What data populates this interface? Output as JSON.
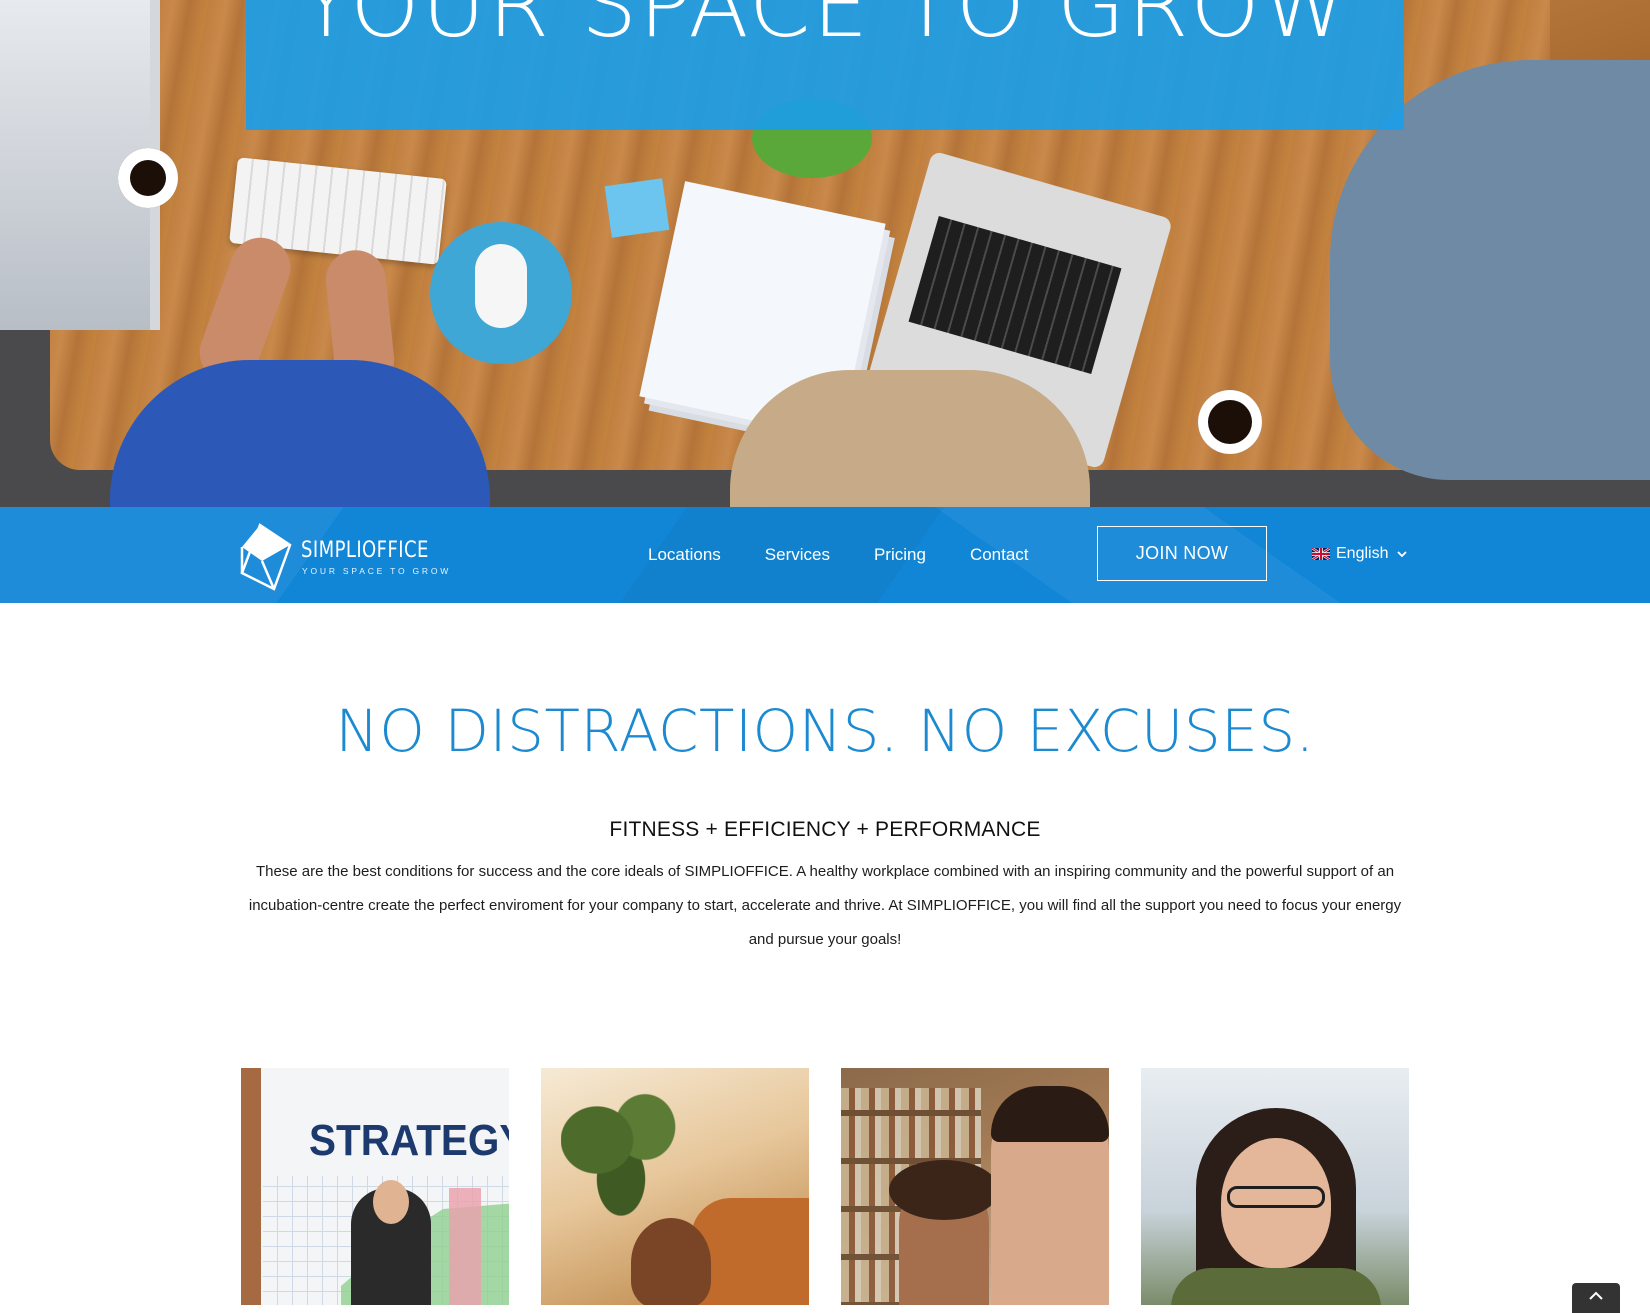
{
  "hero": {
    "title": "YOUR SPACE TO GROW"
  },
  "nav": {
    "logo": {
      "name": "SIMPLIOFFICE",
      "tagline": "YOUR SPACE TO GROW"
    },
    "links": [
      {
        "label": "Locations"
      },
      {
        "label": "Services"
      },
      {
        "label": "Pricing"
      },
      {
        "label": "Contact"
      }
    ],
    "cta_label": "JOIN NOW",
    "language": {
      "label": "English",
      "flag_icon": "uk-flag-icon"
    }
  },
  "main": {
    "heading": "NO DISTRACTIONS. NO EXCUSES.",
    "subheading": "FITNESS + EFFICIENCY + PERFORMANCE",
    "intro": "These are the best conditions for success and the core ideals of SIMPLIOFFICE. A healthy workplace combined with an inspiring community and the powerful support of an incubation-centre create the perfect enviroment for your company to start, accelerate and thrive. At SIMPLIOFFICE, you will find all the support you need to focus your energy and pursue your goals!"
  },
  "cards": [
    {
      "image": "strategy-presentation-photo",
      "visible_text": "STRATEGY"
    },
    {
      "image": "woman-on-sofa-photo"
    },
    {
      "image": "people-studying-photo"
    },
    {
      "image": "woman-with-glasses-photo"
    }
  ],
  "colors": {
    "brand_blue": "#1286d6",
    "heading_blue": "#1b8ad0",
    "banner_blue": "#1b9de8"
  },
  "icons": {
    "logo": "cube-logo-icon",
    "language_chevron": "chevron-down-icon",
    "scroll_top": "chevron-up-icon"
  }
}
